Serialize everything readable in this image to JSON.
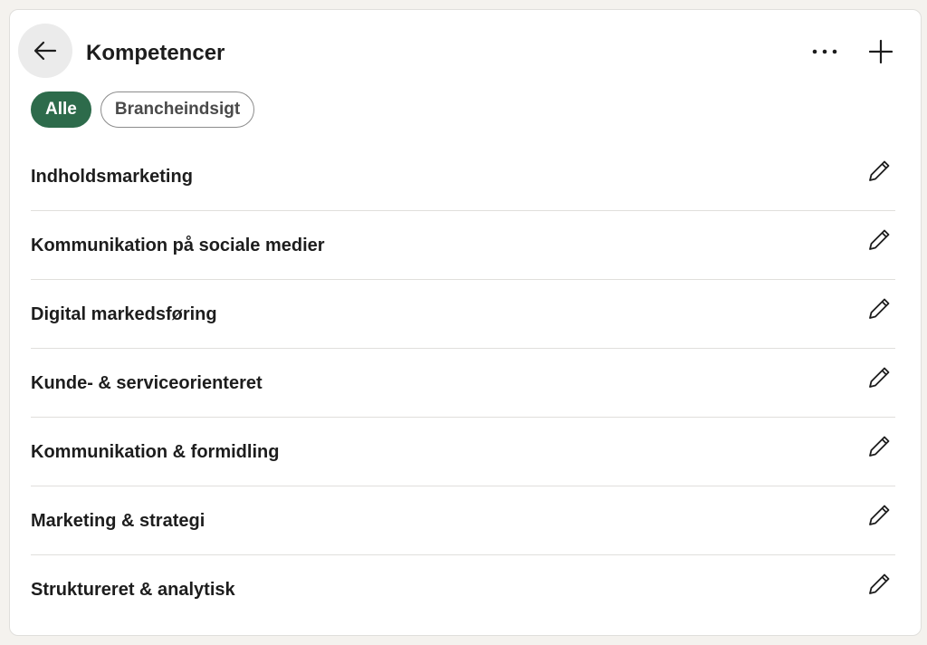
{
  "header": {
    "title": "Kompetencer",
    "back_icon": "arrow-left-icon",
    "more_icon": "more-horizontal-icon",
    "add_icon": "plus-icon"
  },
  "filters": [
    {
      "label": "Alle",
      "active": true
    },
    {
      "label": "Brancheindsigt",
      "active": false
    }
  ],
  "skills": [
    {
      "label": "Indholdsmarketing"
    },
    {
      "label": "Kommunikation på sociale medier"
    },
    {
      "label": "Digital markedsføring"
    },
    {
      "label": "Kunde- & serviceorienteret"
    },
    {
      "label": "Kommunikation & formidling"
    },
    {
      "label": "Marketing & strategi"
    },
    {
      "label": "Struktureret & analytisk"
    }
  ],
  "edit_icon": "pencil-icon",
  "colors": {
    "accent": "#2d6b4b",
    "background": "#f4f2ee",
    "card": "#ffffff",
    "divider": "#e0dfdc"
  }
}
